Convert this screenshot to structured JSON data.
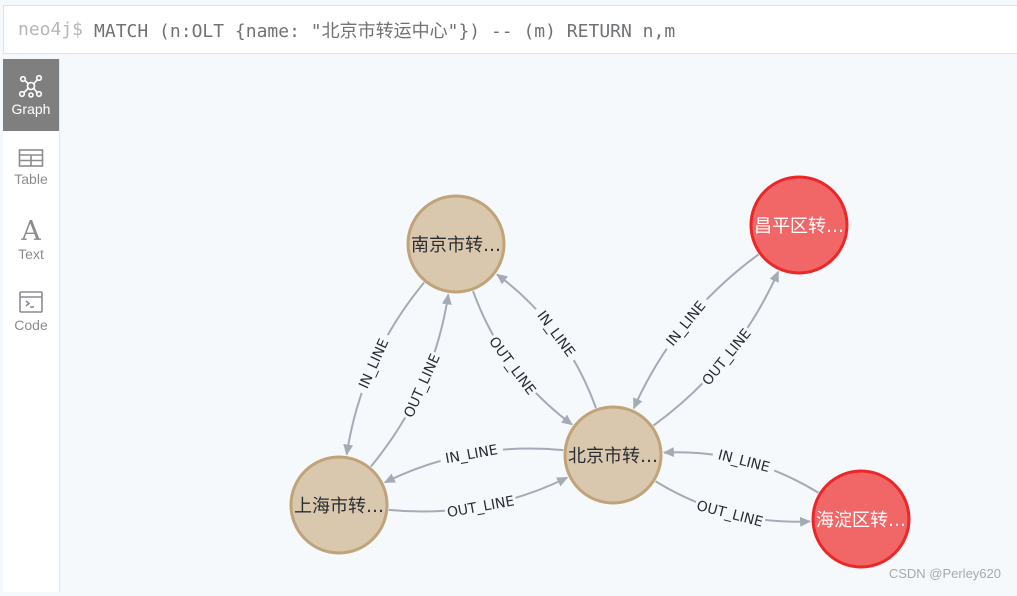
{
  "editor": {
    "prompt": "neo4j$",
    "query": "MATCH (n:OLT {name: \"北京市转运中心\"}) -- (m) RETURN n,m"
  },
  "sidebar": {
    "items": [
      {
        "label": "Graph",
        "icon": "graph-icon",
        "active": true
      },
      {
        "label": "Table",
        "icon": "table-icon",
        "active": false
      },
      {
        "label": "Text",
        "icon": "text-icon",
        "active": false
      },
      {
        "label": "Code",
        "icon": "code-icon",
        "active": false
      }
    ]
  },
  "colors": {
    "tan_fill": "#d9c8ae",
    "tan_stroke": "#c0a378",
    "red_fill": "#f16667",
    "red_stroke": "#eb2728",
    "edge": "#a5abb6",
    "label_dark": "#2a2c34",
    "label_light": "#ffffff"
  },
  "graph": {
    "nodes": [
      {
        "id": "nanjing",
        "caption": "南京市转…",
        "style": "tan"
      },
      {
        "id": "shanghai",
        "caption": "上海市转…",
        "style": "tan"
      },
      {
        "id": "beijing",
        "caption": "北京市转…",
        "style": "tan"
      },
      {
        "id": "changping",
        "caption": "昌平区转…",
        "style": "red"
      },
      {
        "id": "haidian",
        "caption": "海淀区转…",
        "style": "red"
      }
    ],
    "relationships": [
      {
        "from": "shanghai",
        "to": "nanjing",
        "type": "OUT_LINE"
      },
      {
        "from": "nanjing",
        "to": "shanghai",
        "type": "IN_LINE"
      },
      {
        "from": "nanjing",
        "to": "beijing",
        "type": "OUT_LINE"
      },
      {
        "from": "beijing",
        "to": "nanjing",
        "type": "IN_LINE"
      },
      {
        "from": "shanghai",
        "to": "beijing",
        "type": "OUT_LINE"
      },
      {
        "from": "beijing",
        "to": "shanghai",
        "type": "IN_LINE"
      },
      {
        "from": "beijing",
        "to": "changping",
        "type": "OUT_LINE"
      },
      {
        "from": "changping",
        "to": "beijing",
        "type": "IN_LINE"
      },
      {
        "from": "beijing",
        "to": "haidian",
        "type": "OUT_LINE"
      },
      {
        "from": "haidian",
        "to": "beijing",
        "type": "IN_LINE"
      }
    ]
  },
  "watermark": "CSDN @Perley620"
}
